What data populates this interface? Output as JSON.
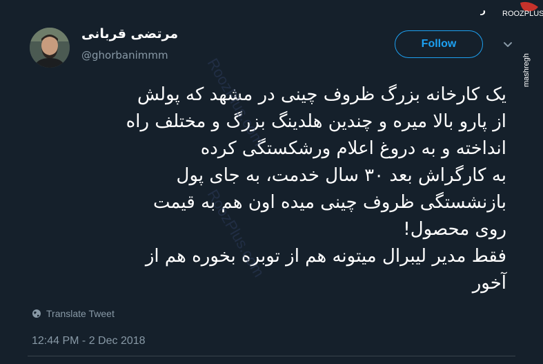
{
  "user": {
    "display_name": "مرتضی قربانی",
    "handle": "@ghorbanimmm"
  },
  "follow_label": "Follow",
  "tweet": {
    "lines": [
      "یک کارخانه بزرگ ظروف چینی در مشهد که پولش",
      "از پارو بالا میره و چندین هلدینگ بزرگ و مختلف راه",
      "انداخته و به دروغ اعلام ورشکستگی کرده",
      "به کارگراش بعد ۳۰ سال خدمت، به جای پول",
      "بازنشستگی ظروف چینی میده اون هم به قیمت",
      "روی محصول!",
      "فقط مدیر لیبرال میتونه هم از توبره بخوره هم از",
      "آخور"
    ]
  },
  "translate_label": "Translate Tweet",
  "timestamp": "12:44 PM - 2 Dec 2018",
  "watermark": {
    "site": "ROOZPLUS.com",
    "side": "mashregh",
    "diagonal": "RoozPlus.com"
  },
  "colors": {
    "background": "#15202b",
    "accent": "#1da1f2",
    "muted": "#8899a6"
  },
  "icons": [
    "avatar-photo",
    "chevron-down-icon",
    "globe-icon",
    "roozplus-logo"
  ]
}
